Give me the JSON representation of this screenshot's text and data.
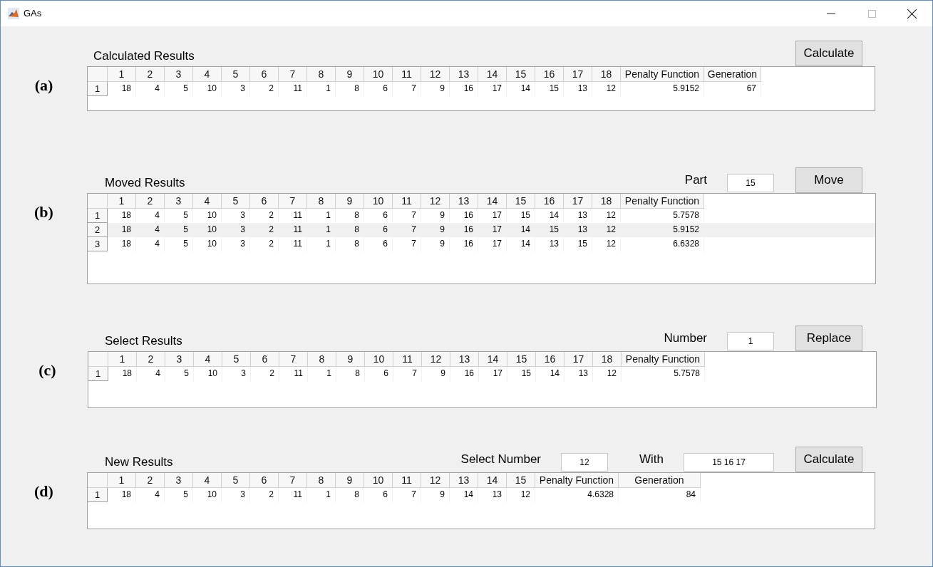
{
  "window": {
    "title": "GAs"
  },
  "sections": [
    {
      "label": "(a)",
      "title": "Calculated Results",
      "controls": [
        {
          "kind": "button",
          "text": "Calculate"
        }
      ],
      "table": {
        "columns": [
          "1",
          "2",
          "3",
          "4",
          "5",
          "6",
          "7",
          "8",
          "9",
          "10",
          "11",
          "12",
          "13",
          "14",
          "15",
          "16",
          "17",
          "18",
          "Penalty Function",
          "Generation"
        ],
        "rows": [
          {
            "header": "1",
            "cells": [
              "18",
              "4",
              "5",
              "10",
              "3",
              "2",
              "11",
              "1",
              "8",
              "6",
              "7",
              "9",
              "16",
              "17",
              "14",
              "15",
              "13",
              "12",
              "5.9152",
              "67"
            ]
          }
        ]
      }
    },
    {
      "label": "(b)",
      "title": "Moved Results",
      "controls": [
        {
          "kind": "label",
          "text": "Part"
        },
        {
          "kind": "field",
          "text": "15"
        },
        {
          "kind": "button",
          "text": "Move"
        }
      ],
      "table": {
        "columns": [
          "1",
          "2",
          "3",
          "4",
          "5",
          "6",
          "7",
          "8",
          "9",
          "10",
          "11",
          "12",
          "13",
          "14",
          "15",
          "16",
          "17",
          "18",
          "Penalty Function"
        ],
        "rows": [
          {
            "header": "1",
            "cells": [
              "18",
              "4",
              "5",
              "10",
              "3",
              "2",
              "11",
              "1",
              "8",
              "6",
              "7",
              "9",
              "16",
              "17",
              "15",
              "14",
              "13",
              "12",
              "5.7578"
            ]
          },
          {
            "header": "2",
            "cells": [
              "18",
              "4",
              "5",
              "10",
              "3",
              "2",
              "11",
              "1",
              "8",
              "6",
              "7",
              "9",
              "16",
              "17",
              "14",
              "15",
              "13",
              "12",
              "5.9152"
            ]
          },
          {
            "header": "3",
            "cells": [
              "18",
              "4",
              "5",
              "10",
              "3",
              "2",
              "11",
              "1",
              "8",
              "6",
              "7",
              "9",
              "16",
              "17",
              "14",
              "13",
              "15",
              "12",
              "6.6328"
            ]
          }
        ]
      }
    },
    {
      "label": "(c)",
      "title": "Select Results",
      "controls": [
        {
          "kind": "label",
          "text": "Number"
        },
        {
          "kind": "field",
          "text": "1"
        },
        {
          "kind": "button",
          "text": "Replace"
        }
      ],
      "table": {
        "columns": [
          "1",
          "2",
          "3",
          "4",
          "5",
          "6",
          "7",
          "8",
          "9",
          "10",
          "11",
          "12",
          "13",
          "14",
          "15",
          "16",
          "17",
          "18",
          "Penalty Function"
        ],
        "rows": [
          {
            "header": "1",
            "cells": [
              "18",
              "4",
              "5",
              "10",
              "3",
              "2",
              "11",
              "1",
              "8",
              "6",
              "7",
              "9",
              "16",
              "17",
              "15",
              "14",
              "13",
              "12",
              "5.7578"
            ]
          }
        ]
      }
    },
    {
      "label": "(d)",
      "title": "New Results",
      "controls": [
        {
          "kind": "label",
          "text": "Select Number"
        },
        {
          "kind": "field",
          "text": "12"
        },
        {
          "kind": "label",
          "text": "With"
        },
        {
          "kind": "widefield",
          "text": "15 16 17"
        },
        {
          "kind": "button",
          "text": "Calculate"
        }
      ],
      "table": {
        "columns": [
          "1",
          "2",
          "3",
          "4",
          "5",
          "6",
          "7",
          "8",
          "9",
          "10",
          "11",
          "12",
          "13",
          "14",
          "15",
          "Penalty Function",
          "Generation"
        ],
        "rows": [
          {
            "header": "1",
            "cells": [
              "18",
              "4",
              "5",
              "10",
              "3",
              "2",
              "11",
              "1",
              "8",
              "6",
              "7",
              "9",
              "14",
              "13",
              "12",
              "4.6328",
              "84"
            ]
          }
        ]
      }
    }
  ]
}
